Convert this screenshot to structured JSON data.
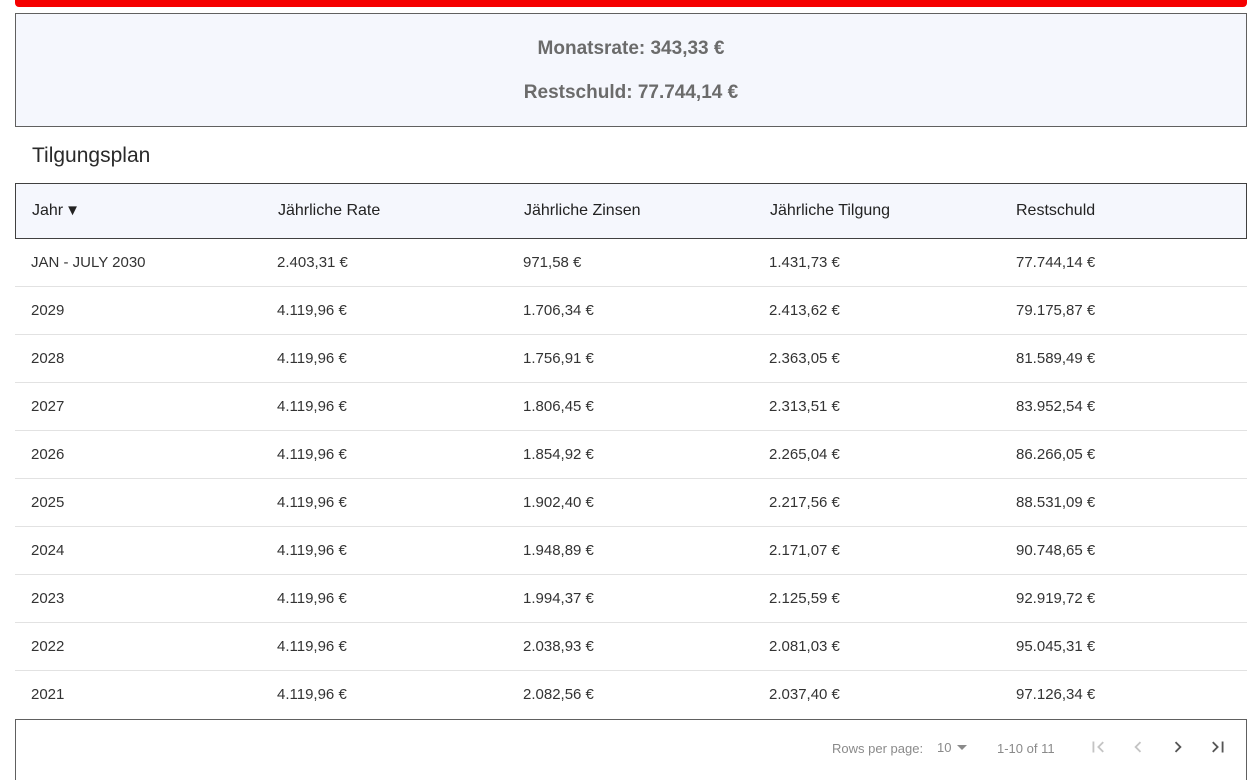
{
  "summary": {
    "monthly_rate": "Monatsrate: 343,33 €",
    "remaining_debt": "Restschuld: 77.744,14 €"
  },
  "section_title": "Tilgungsplan",
  "table": {
    "columns": [
      "Jahr",
      "Jährliche Rate",
      "Jährliche Zinsen",
      "Jährliche Tilgung",
      "Restschuld"
    ],
    "sort_indicator": "▼",
    "rows": [
      [
        "JAN - JULY 2030",
        "2.403,31 €",
        "971,58 €",
        "1.431,73 €",
        "77.744,14 €"
      ],
      [
        "2029",
        "4.119,96 €",
        "1.706,34 €",
        "2.413,62 €",
        "79.175,87 €"
      ],
      [
        "2028",
        "4.119,96 €",
        "1.756,91 €",
        "2.363,05 €",
        "81.589,49 €"
      ],
      [
        "2027",
        "4.119,96 €",
        "1.806,45 €",
        "2.313,51 €",
        "83.952,54 €"
      ],
      [
        "2026",
        "4.119,96 €",
        "1.854,92 €",
        "2.265,04 €",
        "86.266,05 €"
      ],
      [
        "2025",
        "4.119,96 €",
        "1.902,40 €",
        "2.217,56 €",
        "88.531,09 €"
      ],
      [
        "2024",
        "4.119,96 €",
        "1.948,89 €",
        "2.171,07 €",
        "90.748,65 €"
      ],
      [
        "2023",
        "4.119,96 €",
        "1.994,37 €",
        "2.125,59 €",
        "92.919,72 €"
      ],
      [
        "2022",
        "4.119,96 €",
        "2.038,93 €",
        "2.081,03 €",
        "95.045,31 €"
      ],
      [
        "2021",
        "4.119,96 €",
        "2.082,56 €",
        "2.037,40 €",
        "97.126,34 €"
      ]
    ]
  },
  "pagination": {
    "rows_per_page_label": "Rows per page:",
    "rows_per_page_value": "10",
    "range_label": "1-10 of 11",
    "icons": [
      "first-page-icon",
      "previous-page-icon",
      "next-page-icon",
      "last-page-icon"
    ]
  },
  "colors": {
    "accent_bar": "#f50000",
    "header_bg": "#f5f7fd"
  }
}
